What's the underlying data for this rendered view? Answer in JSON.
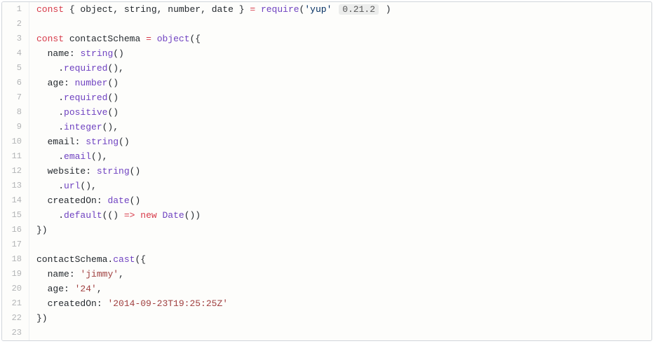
{
  "gutter": [
    "1",
    "2",
    "3",
    "4",
    "5",
    "6",
    "7",
    "8",
    "9",
    "10",
    "11",
    "12",
    "13",
    "14",
    "15",
    "16",
    "17",
    "18",
    "19",
    "20",
    "21",
    "22",
    "23"
  ],
  "t": {
    "const": "const",
    "new": "new",
    "require": "require",
    "object": "object",
    "string": "string",
    "number": "number",
    "date": "date",
    "Date": "Date",
    "required": "required",
    "positive": "positive",
    "integer": "integer",
    "email": "email",
    "url": "url",
    "default": "default",
    "cast": "cast",
    "contactSchema": "contactSchema",
    "name": "name",
    "age": "age",
    "website": "website",
    "createdOn": "createdOn",
    "yup": "'yup'",
    "version": "0.21.2",
    "jimmy": "'jimmy'",
    "v24": "'24'",
    "isoDate": "'2014-09-23T19:25:25Z'"
  }
}
